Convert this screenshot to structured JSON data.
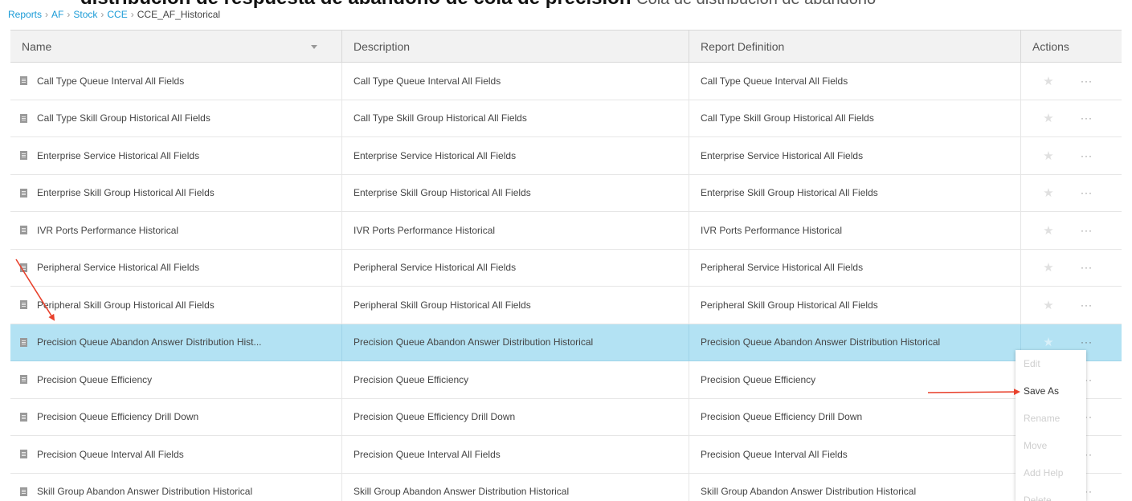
{
  "page_title": {
    "bold": "distribución de respuesta de abandono de cola de precisión",
    "rest": "Cola de distribución de abandono"
  },
  "breadcrumb": {
    "items": [
      "Reports",
      "AF",
      "Stock",
      "CCE"
    ],
    "current": "CCE_AF_Historical"
  },
  "table": {
    "columns": {
      "name": "Name",
      "description": "Description",
      "report_definition": "Report Definition",
      "actions": "Actions"
    },
    "rows": [
      {
        "name": "Call Type Queue Interval All Fields",
        "description": "Call Type Queue Interval All Fields",
        "definition": "Call Type Queue Interval All Fields"
      },
      {
        "name": "Call Type Skill Group Historical All Fields",
        "description": "Call Type Skill Group Historical All Fields",
        "definition": "Call Type Skill Group Historical All Fields"
      },
      {
        "name": "Enterprise Service Historical All Fields",
        "description": "Enterprise Service Historical All Fields",
        "definition": "Enterprise Service Historical All Fields"
      },
      {
        "name": "Enterprise Skill Group Historical All Fields",
        "description": "Enterprise Skill Group Historical All Fields",
        "definition": "Enterprise Skill Group Historical All Fields"
      },
      {
        "name": "IVR Ports Performance Historical",
        "description": "IVR Ports Performance Historical",
        "definition": "IVR Ports Performance Historical"
      },
      {
        "name": "Peripheral Service Historical All Fields",
        "description": "Peripheral Service Historical All Fields",
        "definition": "Peripheral Service Historical All Fields"
      },
      {
        "name": "Peripheral Skill Group Historical All Fields",
        "description": "Peripheral Skill Group Historical All Fields",
        "definition": "Peripheral Skill Group Historical All Fields"
      },
      {
        "name": "Precision Queue Abandon Answer Distribution Hist...",
        "description": "Precision Queue Abandon Answer Distribution Historical",
        "definition": "Precision Queue Abandon Answer Distribution Historical"
      },
      {
        "name": "Precision Queue Efficiency",
        "description": "Precision Queue Efficiency",
        "definition": "Precision Queue Efficiency"
      },
      {
        "name": "Precision Queue Efficiency Drill Down",
        "description": "Precision Queue Efficiency Drill Down",
        "definition": "Precision Queue Efficiency Drill Down"
      },
      {
        "name": "Precision Queue Interval All Fields",
        "description": "Precision Queue Interval All Fields",
        "definition": "Precision Queue Interval All Fields"
      },
      {
        "name": "Skill Group Abandon Answer Distribution Historical",
        "description": "Skill Group Abandon Answer Distribution Historical",
        "definition": "Skill Group Abandon Answer Distribution Historical"
      }
    ],
    "selected_index": 7,
    "star_glyph": "★",
    "more_glyph": "···"
  },
  "context_menu": {
    "items": [
      "Edit",
      "Save As",
      "Rename",
      "Move",
      "Add Help",
      "Delete"
    ]
  },
  "colors": {
    "selected_row": "#b3e2f3",
    "link": "#1a9bd7",
    "annotation_arrow": "#e8412c"
  }
}
